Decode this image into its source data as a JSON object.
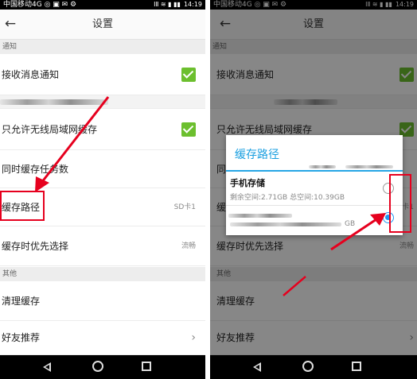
{
  "status_bar": {
    "carrier": "中国移动4G",
    "icon_text": "◎ ▣ ✉ ⚙",
    "right_icons": "ⅠⅡ ≋ ▮ ▮▮",
    "time": "14:19"
  },
  "header": {
    "back_icon": "←",
    "title": "设置"
  },
  "settings": {
    "notify_section": "通知",
    "receive_notify": "接收消息通知",
    "wifi_only_cache": "只允许无线局域网缓存",
    "concurrent_tasks": "同时缓存任务数",
    "cache_path": "缓存路径",
    "cache_path_value": "SD卡1",
    "cache_priority": "缓存时优先选择",
    "cache_priority_value": "流畅",
    "other_section": "其他",
    "clear_cache": "清理缓存",
    "recommend_friends": "好友推荐",
    "chevron": "›"
  },
  "dialog": {
    "title": "缓存路径",
    "option_phone_title": "手机存储",
    "option_phone_detail": "剩余空间:2.71GB  总空间:10.39GB",
    "option_sd_suffix": "GB",
    "selected_option": "sd-card"
  },
  "colors": {
    "accent_blue": "#1a9fe0",
    "check_green": "#6cbf2e",
    "annotation_red": "#e6001e"
  }
}
